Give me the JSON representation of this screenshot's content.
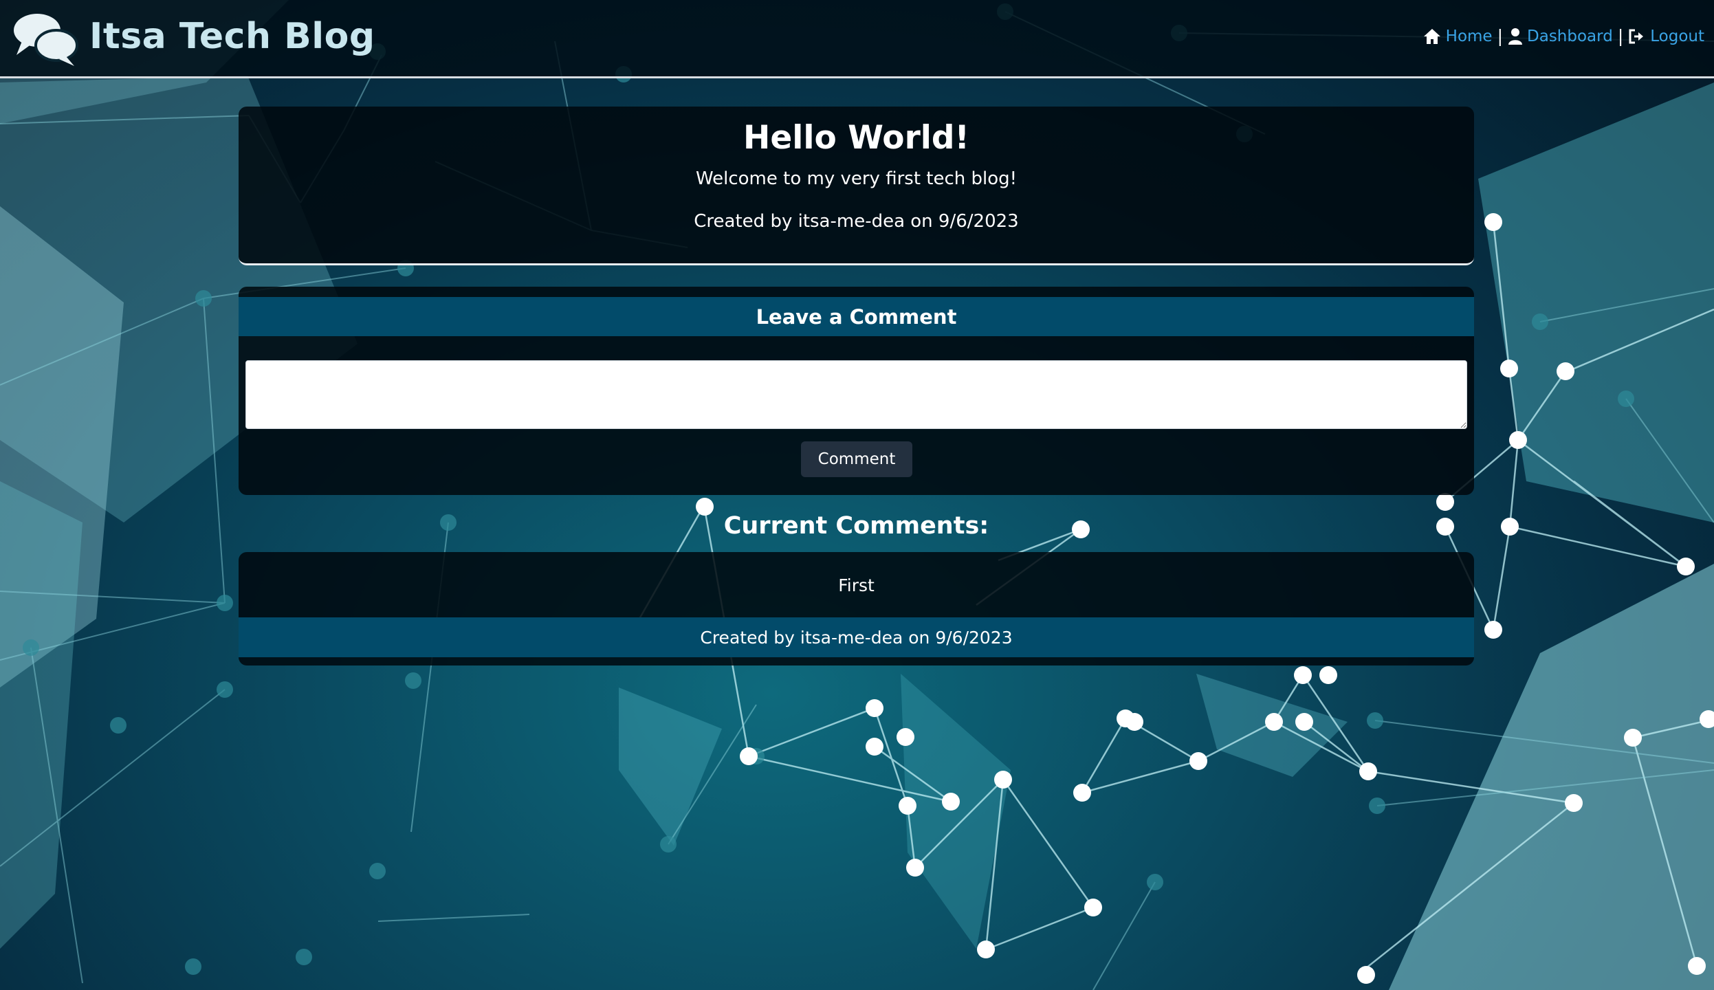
{
  "navbar": {
    "brand_title": "Itsa Tech Blog",
    "brand_icon": "chat-bubbles-icon",
    "links": [
      {
        "label": "Home",
        "icon": "home-icon"
      },
      {
        "label": "Dashboard",
        "icon": "user-icon"
      },
      {
        "label": "Logout",
        "icon": "logout-icon"
      }
    ],
    "separator": "|",
    "link_color": "#3aa4e6"
  },
  "post": {
    "title": "Hello World!",
    "body": "Welcome to my very first tech blog!",
    "meta": "Created by itsa-me-dea on 9/6/2023"
  },
  "comment_form": {
    "header": "Leave a Comment",
    "textarea_value": "",
    "button_label": "Comment"
  },
  "comments": {
    "title": "Current Comments:",
    "items": [
      {
        "text": "First",
        "meta": "Created by itsa-me-dea on 9/6/2023"
      }
    ]
  },
  "colors": {
    "accent": "#024b6a",
    "button": "#23303f",
    "brand_text": "#c9e6ee"
  }
}
